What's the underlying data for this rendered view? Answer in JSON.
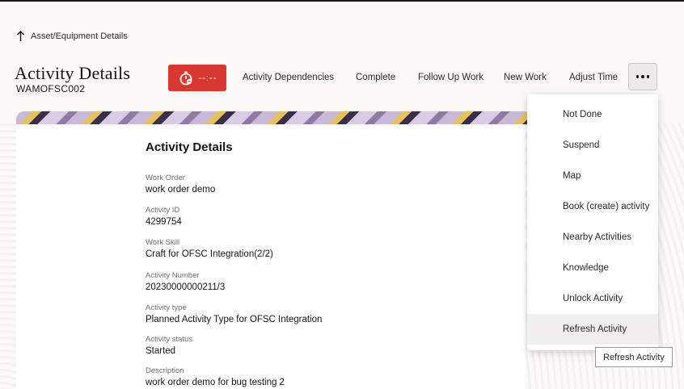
{
  "back": {
    "label": "Asset/Equipment Details",
    "icon": "arrow-up-icon"
  },
  "header": {
    "title": "Activity Details",
    "subtitle": "WAMOFSC002",
    "timer": {
      "label": "--:--",
      "icon": "timer-icon",
      "color": "#d8382f"
    }
  },
  "actions": [
    {
      "label": "Activity Dependencies"
    },
    {
      "label": "Complete"
    },
    {
      "label": "Follow Up Work"
    },
    {
      "label": "New Work"
    },
    {
      "label": "Adjust Time"
    }
  ],
  "more_button": {
    "icon": "more-horizontal-icon"
  },
  "card": {
    "title": "Activity Details",
    "fields": [
      {
        "label": "Work Order",
        "value": "work order demo"
      },
      {
        "label": "Activity ID",
        "value": "4299754"
      },
      {
        "label": "Work Skill",
        "value": "Craft for OFSC Integration(2/2)"
      },
      {
        "label": "Activity Number",
        "value": "20230000000211/3"
      },
      {
        "label": "Activity type",
        "value": "Planned Activity Type for OFSC Integration"
      },
      {
        "label": "Activity status",
        "value": "Started"
      },
      {
        "label": "Description",
        "value": "work order demo for bug testing 2"
      }
    ]
  },
  "menu": {
    "items": [
      {
        "label": "Not Done"
      },
      {
        "label": "Suspend"
      },
      {
        "label": "Map"
      },
      {
        "label": "Book (create) activity"
      },
      {
        "label": "Nearby Activities"
      },
      {
        "label": "Knowledge"
      },
      {
        "label": "Unlock Activity"
      },
      {
        "label": "Refresh Activity",
        "hovered": true
      }
    ]
  },
  "tooltip": {
    "text": "Refresh Activity"
  }
}
